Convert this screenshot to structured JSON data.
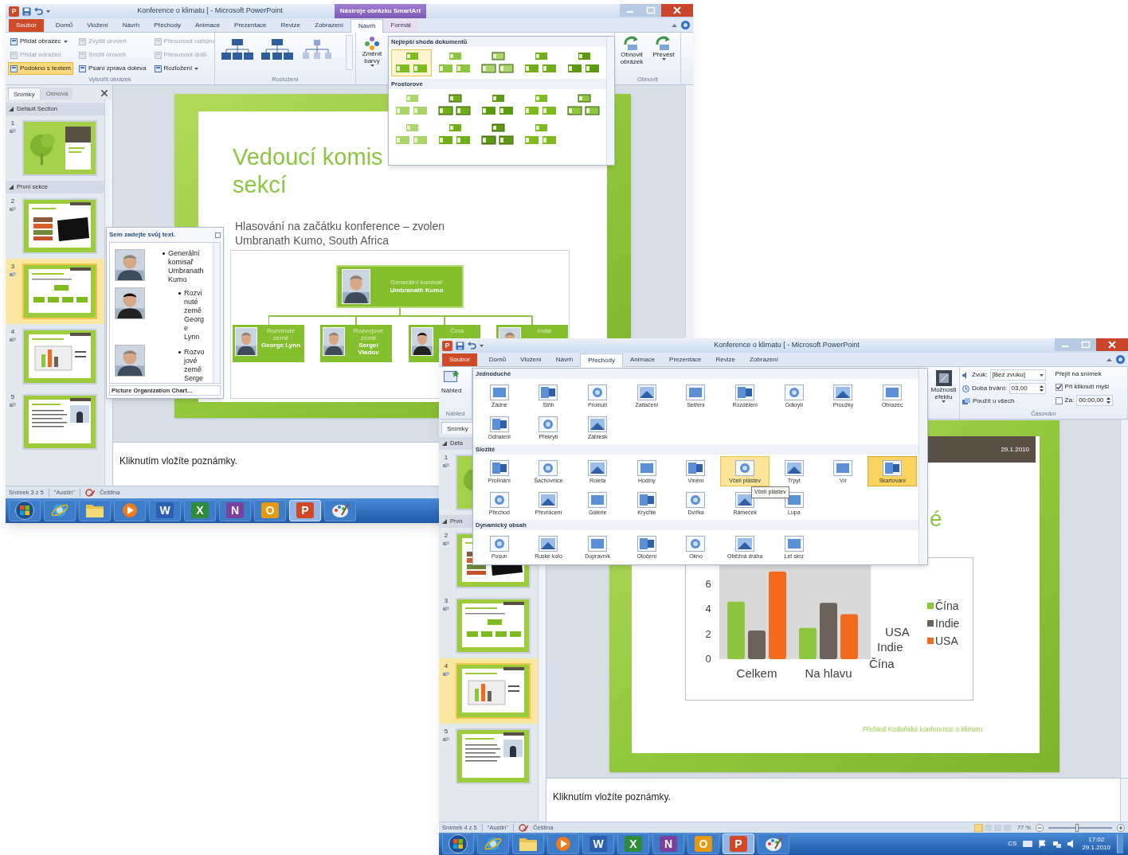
{
  "window_1": {
    "app_icon_letter": "P",
    "title": "Konference o klimatu [ - Microsoft PowerPoint",
    "context_label": "Nástroje obrázku SmartArt",
    "tabs": [
      {
        "label": "Soubor",
        "kind": "file",
        "selected": false
      },
      {
        "label": "Domů",
        "kind": "tab",
        "selected": false
      },
      {
        "label": "Vložení",
        "kind": "tab",
        "selected": false
      },
      {
        "label": "Návrh",
        "kind": "tab",
        "selected": false
      },
      {
        "label": "Přechody",
        "kind": "tab",
        "selected": false
      },
      {
        "label": "Animace",
        "kind": "tab",
        "selected": false
      },
      {
        "label": "Prezentace",
        "kind": "tab",
        "selected": false
      },
      {
        "label": "Revize",
        "kind": "tab",
        "selected": false
      },
      {
        "label": "Zobrazení",
        "kind": "tab",
        "selected": false
      },
      {
        "label": "Návrh",
        "kind": "context",
        "selected": true
      },
      {
        "label": "Formát",
        "kind": "context",
        "selected": false
      }
    ],
    "create_group": {
      "label": "Vytvořit obrázek",
      "columns": [
        [
          {
            "label": "Přidat obrazec",
            "dropdown": true,
            "disabled": false,
            "selected": false
          },
          {
            "label": "Přidat odrážku",
            "dropdown": false,
            "disabled": true,
            "selected": false
          },
          {
            "label": "Podokno s textem",
            "dropdown": false,
            "disabled": false,
            "selected": true
          }
        ],
        [
          {
            "label": "Zvýšit úroveň",
            "dropdown": false,
            "disabled": true,
            "selected": false
          },
          {
            "label": "Snížit úroveň",
            "dropdown": false,
            "disabled": true,
            "selected": false
          },
          {
            "label": "Psaní zprava doleva",
            "dropdown": false,
            "disabled": false,
            "selected": false
          }
        ],
        [
          {
            "label": "Přesunout nahoru",
            "dropdown": false,
            "disabled": true,
            "selected": false
          },
          {
            "label": "Přesunout dolů",
            "dropdown": false,
            "disabled": true,
            "selected": false
          },
          {
            "label": "Rozložení",
            "dropdown": true,
            "disabled": false,
            "selected": false
          }
        ]
      ]
    },
    "layouts_group": {
      "label": "Rozložení"
    },
    "colors_button": {
      "label": "Změnit barvy",
      "dropdown": true
    },
    "style_gallery": {
      "sections": [
        {
          "title": "Nejlepší shoda dokumentů",
          "items": [
            {
              "selected": true
            },
            {
              "selected": false
            },
            {
              "selected": false
            },
            {
              "selected": false
            },
            {
              "selected": false
            }
          ]
        },
        {
          "title": "Prostorové",
          "items": [
            {
              "selected": false
            },
            {
              "selected": false
            },
            {
              "selected": false
            },
            {
              "selected": false
            },
            {
              "selected": false
            },
            {
              "selected": false
            },
            {
              "selected": false
            },
            {
              "selected": false
            },
            {
              "selected": false
            }
          ]
        }
      ]
    },
    "reset_group": {
      "label": "Obnovit",
      "buttons": [
        {
          "label": "Obnovit obrázek",
          "dropdown": false
        },
        {
          "label": "Převést",
          "dropdown": true
        }
      ]
    },
    "slide_panel": {
      "tabs": [
        {
          "label": "Snímky",
          "selected": true
        },
        {
          "label": "Osnova",
          "selected": false
        }
      ],
      "sections": [
        {
          "title": "Default Section",
          "slides": [
            {
              "number": "1",
              "kind": "title",
              "selected": false
            }
          ]
        },
        {
          "title": "První sekce",
          "slides": [
            {
              "number": "2",
              "kind": "picture",
              "selected": false
            },
            {
              "number": "3",
              "kind": "orgchart",
              "selected": true
            },
            {
              "number": "4",
              "kind": "chart",
              "selected": false
            },
            {
              "number": "5",
              "kind": "text",
              "selected": false
            }
          ]
        }
      ]
    },
    "slide": {
      "title_lines": [
        "Vedoucí komis",
        "sekcí"
      ],
      "subtitle_lines": [
        "Hlasování na začátku konference – zvolen",
        "Umbranath Kumo, South Africa"
      ],
      "org_chart": {
        "root": {
          "role": "Generální komisař",
          "name": "Umbranath Kumo"
        },
        "children": [
          {
            "role": "Rozvinuté země",
            "name": "George Lynn"
          },
          {
            "role": "Rozvojové země",
            "name": "Sergei Vladov"
          },
          {
            "role": "Čína"
          },
          {
            "role": "Indie"
          }
        ]
      }
    },
    "text_pane": {
      "title": "Sem zadejte svůj text.",
      "entries": [
        {
          "text": "Generální komisař Umbranath Kumo",
          "children": [
            {
              "text": "Rozvinuté země George Lynn"
            },
            {
              "text": "Rozvojové země Serge"
            }
          ]
        }
      ],
      "footer": "Picture Organization Chart..."
    },
    "notes": "Kliknutím vložíte poznámky.",
    "status": [
      "Snímek 3 z 5",
      "\"Austin\"",
      "Čeština"
    ],
    "taskbar": [
      {
        "kind": "start",
        "selected": false
      },
      {
        "kind": "browser",
        "selected": false
      },
      {
        "kind": "folder",
        "selected": false
      },
      {
        "kind": "media",
        "selected": false
      },
      {
        "kind": "letter",
        "label": "W",
        "color": "#2c5fb2",
        "selected": false
      },
      {
        "kind": "letter",
        "label": "X",
        "color": "#2f8a3a",
        "selected": false
      },
      {
        "kind": "letter",
        "label": "N",
        "color": "#7b3fa0",
        "selected": false
      },
      {
        "kind": "letter",
        "label": "O",
        "color": "#e39a12",
        "selected": false
      },
      {
        "kind": "letter",
        "label": "P",
        "color": "#d24726",
        "selected": true
      },
      {
        "kind": "paint",
        "selected": false
      }
    ]
  },
  "window_2": {
    "app_icon_letter": "P",
    "title": "Konference o klimatu [ - Microsoft PowerPoint",
    "tabs": [
      {
        "label": "Soubor",
        "kind": "file",
        "selected": false
      },
      {
        "label": "Domů",
        "kind": "tab",
        "selected": false
      },
      {
        "label": "Vložení",
        "kind": "tab",
        "selected": false
      },
      {
        "label": "Návrh",
        "kind": "tab",
        "selected": false
      },
      {
        "label": "Přechody",
        "kind": "tab",
        "selected": true
      },
      {
        "label": "Animace",
        "kind": "tab",
        "selected": false
      },
      {
        "label": "Prezentace",
        "kind": "tab",
        "selected": false
      },
      {
        "label": "Revize",
        "kind": "tab",
        "selected": false
      },
      {
        "label": "Zobrazení",
        "kind": "tab",
        "selected": false
      }
    ],
    "preview_group": {
      "label": "Náhled",
      "button": "Náhled"
    },
    "transition_gallery": {
      "sections": [
        {
          "title": "Jednoduché",
          "items": [
            {
              "label": "Žádné",
              "selected": false,
              "hovered": false
            },
            {
              "label": "Střih",
              "selected": false,
              "hovered": false
            },
            {
              "label": "Prolnutí",
              "selected": false,
              "hovered": false
            },
            {
              "label": "Zatlačení",
              "selected": false,
              "hovered": false
            },
            {
              "label": "Setření",
              "selected": false,
              "hovered": false
            },
            {
              "label": "Rozdělení",
              "selected": false,
              "hovered": false
            },
            {
              "label": "Odkrytí",
              "selected": false,
              "hovered": false
            },
            {
              "label": "Proužky",
              "selected": false,
              "hovered": false
            },
            {
              "label": "Obrazec",
              "selected": false,
              "hovered": false
            },
            {
              "label": "Odhalení",
              "selected": false,
              "hovered": false
            },
            {
              "label": "Překrytí",
              "selected": false,
              "hovered": false
            },
            {
              "label": "Záblesk",
              "selected": false,
              "hovered": false
            }
          ]
        },
        {
          "title": "Složité",
          "items": [
            {
              "label": "Prolínání",
              "selected": false,
              "hovered": false
            },
            {
              "label": "Šachovnice",
              "selected": false,
              "hovered": false
            },
            {
              "label": "Roleta",
              "selected": false,
              "hovered": false
            },
            {
              "label": "Hodiny",
              "selected": false,
              "hovered": false
            },
            {
              "label": "Vlnění",
              "selected": false,
              "hovered": false
            },
            {
              "label": "Včelí plástev",
              "selected": false,
              "hovered": true
            },
            {
              "label": "Třpyt",
              "selected": false,
              "hovered": false
            },
            {
              "label": "Vír",
              "selected": false,
              "hovered": false
            },
            {
              "label": "Skartování",
              "selected": true,
              "hovered": false
            },
            {
              "label": "Přechod",
              "selected": false,
              "hovered": false
            },
            {
              "label": "Převrácení",
              "selected": false,
              "hovered": false
            },
            {
              "label": "Galerie",
              "selected": false,
              "hovered": false
            },
            {
              "label": "Krychle",
              "selected": false,
              "hovered": false
            },
            {
              "label": "Dvířka",
              "selected": false,
              "hovered": false
            },
            {
              "label": "Rámeček",
              "selected": false,
              "hovered": false
            },
            {
              "label": "Lupa",
              "selected": false,
              "hovered": false
            }
          ]
        },
        {
          "title": "Dynamický obsah",
          "items": [
            {
              "label": "Posun",
              "selected": false,
              "hovered": false
            },
            {
              "label": "Ruské kolo",
              "selected": false,
              "hovered": false
            },
            {
              "label": "Dopravník",
              "selected": false,
              "hovered": false
            },
            {
              "label": "Otočení",
              "selected": false,
              "hovered": false
            },
            {
              "label": "Okno",
              "selected": false,
              "hovered": false
            },
            {
              "label": "Oběžná dráha",
              "selected": false,
              "hovered": false
            },
            {
              "label": "Let skrz",
              "selected": false,
              "hovered": false
            }
          ]
        }
      ],
      "tooltip": "Včelí plástev"
    },
    "effect_options": {
      "label": "Možnosti efektu",
      "dropdown": true
    },
    "timing_group": {
      "label": "Časování",
      "sound": {
        "label": "Zvuk:",
        "value": "[Bez zvuku]"
      },
      "duration": {
        "label": "Doba trvání:",
        "value": "03,00"
      },
      "apply_all": "Použít u všech",
      "advance_title": "Přejít na snímek",
      "on_click": {
        "label": "Při kliknutí myši",
        "checked": true
      },
      "after": {
        "label": "Za:",
        "checked": false,
        "value": "00:00,00"
      }
    },
    "slide_panel": {
      "tabs": [
        {
          "label": "Snímky",
          "selected": true
        }
      ],
      "sections": [
        {
          "title": "Defa",
          "slides": [
            {
              "number": "1",
              "kind": "title",
              "selected": false
            }
          ]
        },
        {
          "title": "Prvn",
          "slides": [
            {
              "number": "2",
              "kind": "picture",
              "selected": false
            },
            {
              "number": "3",
              "kind": "orgchart",
              "selected": false
            },
            {
              "number": "4",
              "kind": "chart",
              "selected": true
            },
            {
              "number": "5",
              "kind": "text",
              "selected": false
            }
          ]
        }
      ]
    },
    "slide": {
      "date": "29.1.2010",
      "title": "é",
      "chart_data": {
        "type": "bar",
        "categories": [
          "Celkem",
          "Na hlavu"
        ],
        "series": [
          {
            "name": "Čína",
            "color": "#8cc63f",
            "values": [
              4.6,
              2.5
            ]
          },
          {
            "name": "Indie",
            "color": "#6b635a",
            "values": [
              2.3,
              4.5
            ]
          },
          {
            "name": "USA",
            "color": "#f26a1b",
            "values": [
              7,
              3.6
            ]
          }
        ],
        "ylim": [
          0,
          7.5
        ],
        "legend": "right",
        "yticks": [
          {
            "value": 0,
            "label": "0"
          },
          {
            "value": 2,
            "label": "2"
          },
          {
            "value": 4,
            "label": "4"
          },
          {
            "value": 6,
            "label": "6"
          }
        ]
      },
      "depth_labels": [
        "USA",
        "Indie",
        "Čína"
      ],
      "footer": "Přehled Kodaňské konference o klimatu"
    },
    "notes": "Kliknutím vložíte poznámky.",
    "status": [
      "Snímek 4 z 5",
      "\"Austin\"",
      "Čeština"
    ],
    "zoom": {
      "label": "77 %",
      "level": 0.45
    },
    "taskbar": [
      {
        "kind": "start",
        "selected": false
      },
      {
        "kind": "browser",
        "selected": false
      },
      {
        "kind": "folder",
        "selected": false
      },
      {
        "kind": "media",
        "selected": false
      },
      {
        "kind": "letter",
        "label": "W",
        "color": "#2c5fb2",
        "selected": false
      },
      {
        "kind": "letter",
        "label": "X",
        "color": "#2f8a3a",
        "selected": false
      },
      {
        "kind": "letter",
        "label": "N",
        "color": "#7b3fa0",
        "selected": false
      },
      {
        "kind": "letter",
        "label": "O",
        "color": "#e39a12",
        "selected": false
      },
      {
        "kind": "letter",
        "label": "P",
        "color": "#d24726",
        "selected": true
      },
      {
        "kind": "paint",
        "selected": false
      }
    ],
    "tray": {
      "language": "CS",
      "time": "17:02",
      "date": "29.1.2010"
    }
  }
}
